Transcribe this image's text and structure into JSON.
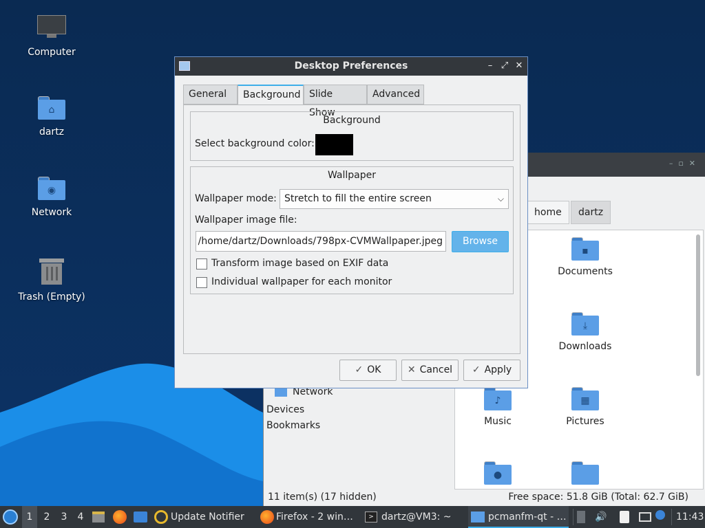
{
  "desktop": {
    "icons": [
      {
        "label": "Computer",
        "icon": "computer-icon"
      },
      {
        "label": "dartz",
        "icon": "home-folder-icon"
      },
      {
        "label": "Network",
        "icon": "network-folder-icon"
      },
      {
        "label": "Trash (Empty)",
        "icon": "trash-icon"
      }
    ]
  },
  "file_manager": {
    "breadcrumb": [
      "home",
      "dartz"
    ],
    "items": [
      "Documents",
      "Downloads",
      "Music",
      "Pictures"
    ],
    "places": [
      "Network",
      "Devices",
      "Bookmarks"
    ],
    "status_left": "11 item(s) (17 hidden)",
    "status_right": "Free space: 51.8 GiB (Total: 62.7 GiB)"
  },
  "dialog": {
    "title": "Desktop Preferences",
    "tabs": [
      "General",
      "Background",
      "Slide Show",
      "Advanced"
    ],
    "active_tab": "Background",
    "background_group": {
      "title": "Background",
      "color_label": "Select background color:",
      "color_value": "#000000"
    },
    "wallpaper_group": {
      "title": "Wallpaper",
      "mode_label": "Wallpaper mode:",
      "mode_value": "Stretch to fill the entire screen",
      "file_label": "Wallpaper image file:",
      "file_value": "/home/dartz/Downloads/798px-CVMWallpaper.jpeg",
      "browse_label": "Browse",
      "exif_label": "Transform image based on EXIF data",
      "exif_checked": false,
      "per_monitor_label": "Individual wallpaper for each monitor",
      "per_monitor_checked": false
    },
    "buttons": {
      "ok": "OK",
      "cancel": "Cancel",
      "apply": "Apply"
    }
  },
  "taskbar": {
    "workspaces": [
      "1",
      "2",
      "3",
      "4"
    ],
    "active_workspace": "1",
    "tasks": [
      "Update Notifier",
      "Firefox - 2 win…",
      "dartz@VM3: ~",
      "pcmanfm-qt - …"
    ],
    "clock": "11:43"
  },
  "colors": {
    "accent": "#3daee9",
    "titlebar": "#33373c",
    "taskbar": "#31363b",
    "folder": "#5b9ee6"
  }
}
